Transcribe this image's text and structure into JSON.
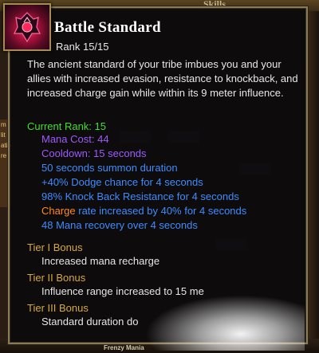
{
  "background": {
    "top_text": "Skills",
    "left_strip": [
      "m",
      "lit",
      "atio",
      "re"
    ],
    "bottom_text": "Frenzy Mania"
  },
  "tooltip": {
    "icon": "battle-standard-skill-icon",
    "title": "Battle Standard",
    "rank": "Rank 15/15",
    "description": "The ancient standard of your tribe imbues you and your allies with increased evasion, resistance to knockback, and increased charge gain while within its 9 meter influence.",
    "current_rank_label": "Current Rank: 15",
    "mana_cost": "Mana Cost: 44",
    "cooldown": "Cooldown: 15 seconds",
    "effects": [
      "50 seconds summon duration",
      "+40% Dodge chance for 4 seconds",
      "98% Knock Back Resistance for 4 seconds"
    ],
    "charge_word": "Charge",
    "charge_rest": " rate increased by 40% for 4 seconds",
    "mana_recovery": "48 Mana recovery over 4 seconds",
    "tiers": [
      {
        "name": "Tier I Bonus",
        "desc": "Increased mana recharge"
      },
      {
        "name": "Tier II Bonus",
        "desc": "Influence range increased to 15 me"
      },
      {
        "name": "Tier III Bonus",
        "desc": "Standard duration do"
      }
    ]
  },
  "colors": {
    "green": "#44dd33",
    "purple": "#9b5bff",
    "blue": "#3f8cff",
    "orange": "#ff8a1e",
    "gold": "#d6a940"
  }
}
